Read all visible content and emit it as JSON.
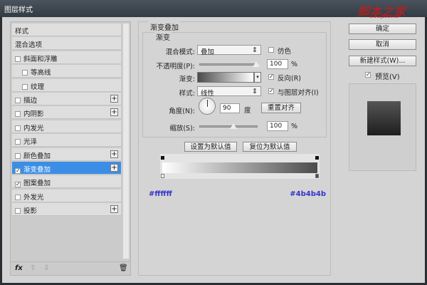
{
  "window": {
    "title": "图层样式"
  },
  "watermark": {
    "text": "脚本之家",
    "sub": "www.jb51.net"
  },
  "sidebar": {
    "items": [
      {
        "label": "样式",
        "checkbox": null,
        "plus": false
      },
      {
        "label": "混合选项",
        "checkbox": null,
        "plus": false
      },
      {
        "label": "斜面和浮雕",
        "checkbox": false,
        "plus": false
      },
      {
        "label": "等高线",
        "checkbox": false,
        "plus": false,
        "indent": true
      },
      {
        "label": "纹理",
        "checkbox": false,
        "plus": false,
        "indent": true
      },
      {
        "label": "描边",
        "checkbox": false,
        "plus": true
      },
      {
        "label": "内阴影",
        "checkbox": false,
        "plus": true
      },
      {
        "label": "内发光",
        "checkbox": false,
        "plus": false
      },
      {
        "label": "光泽",
        "checkbox": false,
        "plus": false
      },
      {
        "label": "颜色叠加",
        "checkbox": false,
        "plus": true
      },
      {
        "label": "渐变叠加",
        "checkbox": true,
        "plus": true,
        "selected": true
      },
      {
        "label": "图案叠加",
        "checkbox": true,
        "plus": false
      },
      {
        "label": "外发光",
        "checkbox": false,
        "plus": false
      },
      {
        "label": "投影",
        "checkbox": false,
        "plus": true
      }
    ],
    "footer": {
      "fx": "fx"
    }
  },
  "panel": {
    "title": "渐变叠加",
    "group": "渐变",
    "blend_label": "混合模式:",
    "blend_value": "叠加",
    "dither_label": "仿色",
    "dither": false,
    "opacity_label": "不透明度(P):",
    "opacity": "100",
    "pct": "%",
    "gradient_label": "渐变:",
    "reverse_label": "反向(R)",
    "reverse": true,
    "style_label": "样式:",
    "style_value": "线性",
    "align_label": "与图层对齐(I)",
    "align": true,
    "angle_label": "角度(N):",
    "angle": "90",
    "angle_unit": "度",
    "reset_align": "重置对齐",
    "scale_label": "缩放(S):",
    "scale": "100",
    "set_default": "设置为默认值",
    "reset_default": "复位为默认值"
  },
  "gradient_editor": {
    "left_color": "#ffffff",
    "right_color": "#4b4b4b"
  },
  "buttons": {
    "ok": "确定",
    "cancel": "取消",
    "new_style": "新建样式(W)...",
    "preview_label": "预览(V)",
    "preview": true
  }
}
